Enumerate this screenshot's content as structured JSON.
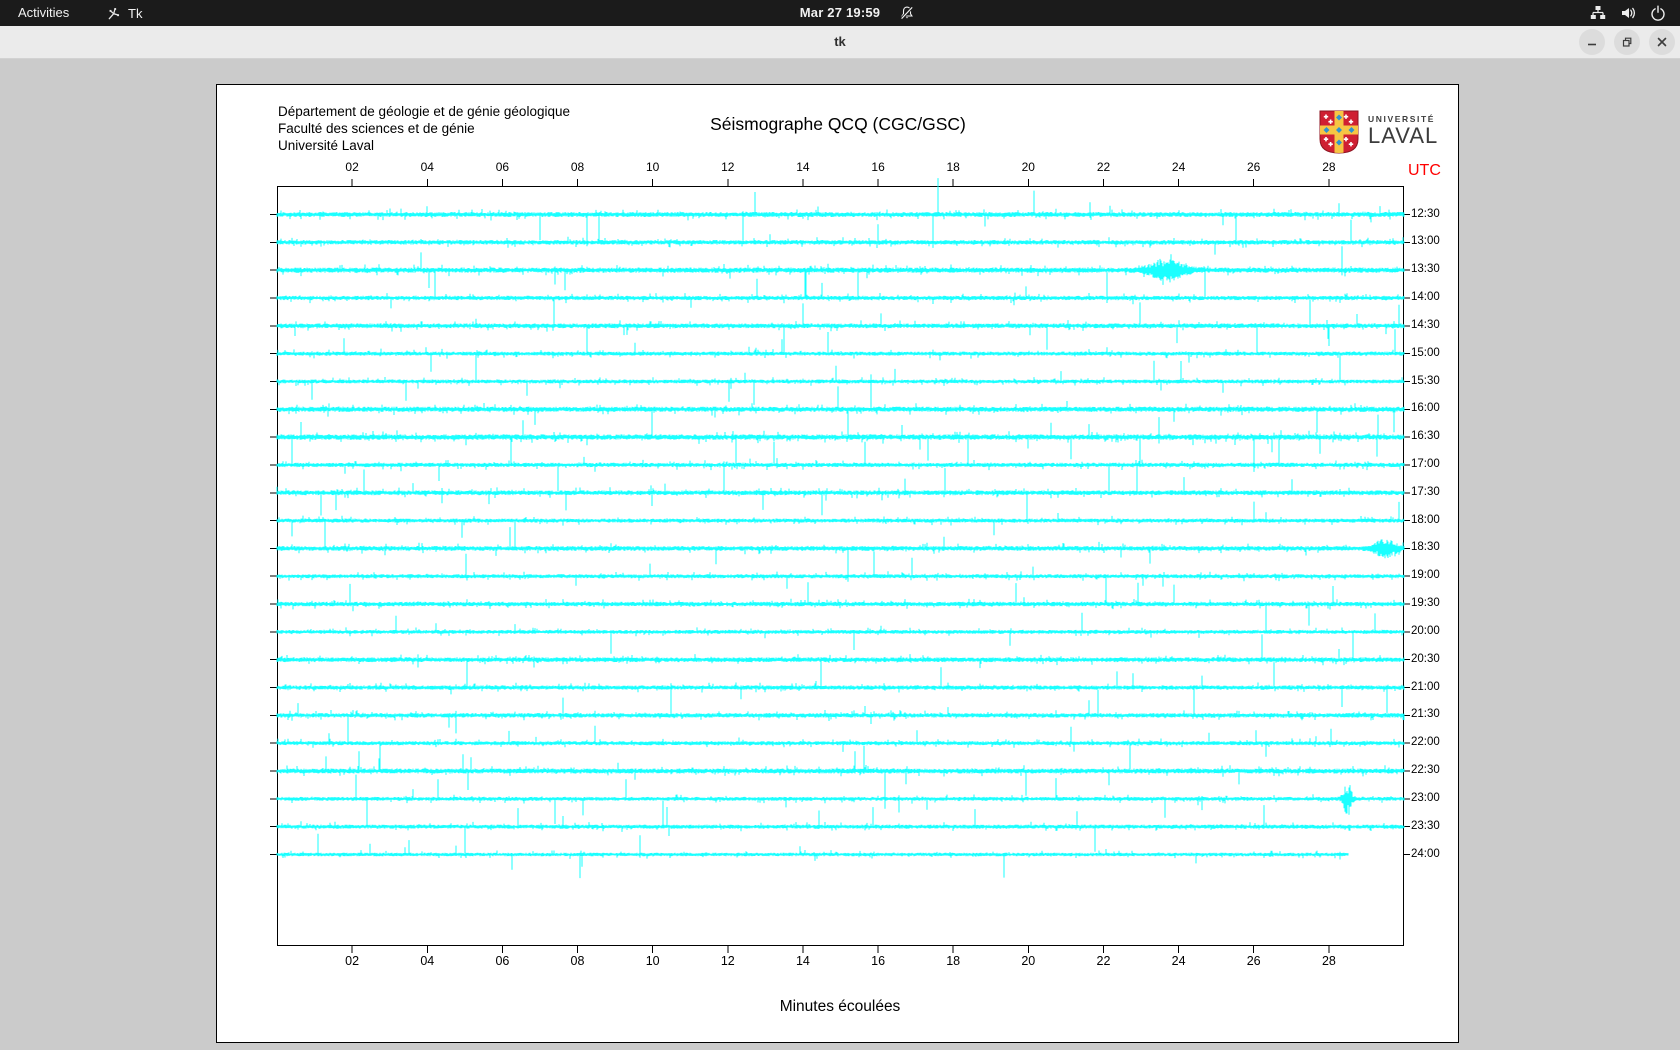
{
  "topbar": {
    "activities": "Activities",
    "app_name": "Tk",
    "clock": "Mar 27 19:59"
  },
  "titlebar": {
    "title": "tk"
  },
  "canvas_header": {
    "line1": "Département de géologie et de génie géologique",
    "line2": "Faculté des sciences et de génie",
    "line3": "Université Laval"
  },
  "logo": {
    "top": "UNIVERSITÉ",
    "bottom": "LAVAL"
  },
  "chart_data": {
    "type": "seismograph",
    "title": "Séismographe QCQ (CGC/GSC)",
    "xlabel": "Minutes écoulées",
    "utc_label": "UTC",
    "x_range_minutes": [
      0,
      30
    ],
    "x_tick_labels": [
      "02",
      "04",
      "06",
      "08",
      "10",
      "12",
      "14",
      "16",
      "18",
      "20",
      "22",
      "24",
      "26",
      "28"
    ],
    "trace_color": "#00ffff",
    "axis_color": "#000000",
    "utc_color": "#ff0000",
    "rows": [
      {
        "time": "12:30",
        "seed": 101,
        "gain": 1.1,
        "end": 1
      },
      {
        "time": "13:00",
        "seed": 102,
        "gain": 1.0,
        "end": 1
      },
      {
        "time": "13:30",
        "seed": 103,
        "gain": 1.15,
        "end": 1,
        "bursts": [
          {
            "m": 23.7,
            "w": 0.5,
            "a": 9
          }
        ]
      },
      {
        "time": "14:00",
        "seed": 104,
        "gain": 0.95,
        "end": 1
      },
      {
        "time": "14:30",
        "seed": 105,
        "gain": 1.05,
        "end": 1
      },
      {
        "time": "15:00",
        "seed": 106,
        "gain": 0.9,
        "end": 1
      },
      {
        "time": "15:30",
        "seed": 107,
        "gain": 0.85,
        "end": 1
      },
      {
        "time": "16:00",
        "seed": 108,
        "gain": 1.15,
        "end": 1
      },
      {
        "time": "16:30",
        "seed": 109,
        "gain": 1.2,
        "end": 1
      },
      {
        "time": "17:00",
        "seed": 110,
        "gain": 0.95,
        "end": 1
      },
      {
        "time": "17:30",
        "seed": 111,
        "gain": 1.05,
        "end": 1
      },
      {
        "time": "18:00",
        "seed": 112,
        "gain": 0.9,
        "end": 1
      },
      {
        "time": "18:30",
        "seed": 113,
        "gain": 1.05,
        "end": 1,
        "bursts": [
          {
            "m": 29.5,
            "w": 0.3,
            "a": 8
          }
        ]
      },
      {
        "time": "19:00",
        "seed": 114,
        "gain": 0.9,
        "end": 1
      },
      {
        "time": "19:30",
        "seed": 115,
        "gain": 1.0,
        "end": 1
      },
      {
        "time": "20:00",
        "seed": 116,
        "gain": 0.85,
        "end": 1
      },
      {
        "time": "20:30",
        "seed": 117,
        "gain": 1.05,
        "end": 1
      },
      {
        "time": "21:00",
        "seed": 118,
        "gain": 0.95,
        "end": 1
      },
      {
        "time": "21:30",
        "seed": 119,
        "gain": 1.0,
        "end": 1
      },
      {
        "time": "22:00",
        "seed": 120,
        "gain": 0.9,
        "end": 1
      },
      {
        "time": "22:30",
        "seed": 121,
        "gain": 1.1,
        "end": 1
      },
      {
        "time": "23:00",
        "seed": 122,
        "gain": 0.85,
        "end": 1,
        "bursts": [
          {
            "m": 28.5,
            "w": 0.12,
            "a": 14
          }
        ]
      },
      {
        "time": "23:30",
        "seed": 123,
        "gain": 0.9,
        "end": 1
      },
      {
        "time": "24:00",
        "seed": 124,
        "gain": 0.8,
        "end": 0.95
      }
    ]
  }
}
